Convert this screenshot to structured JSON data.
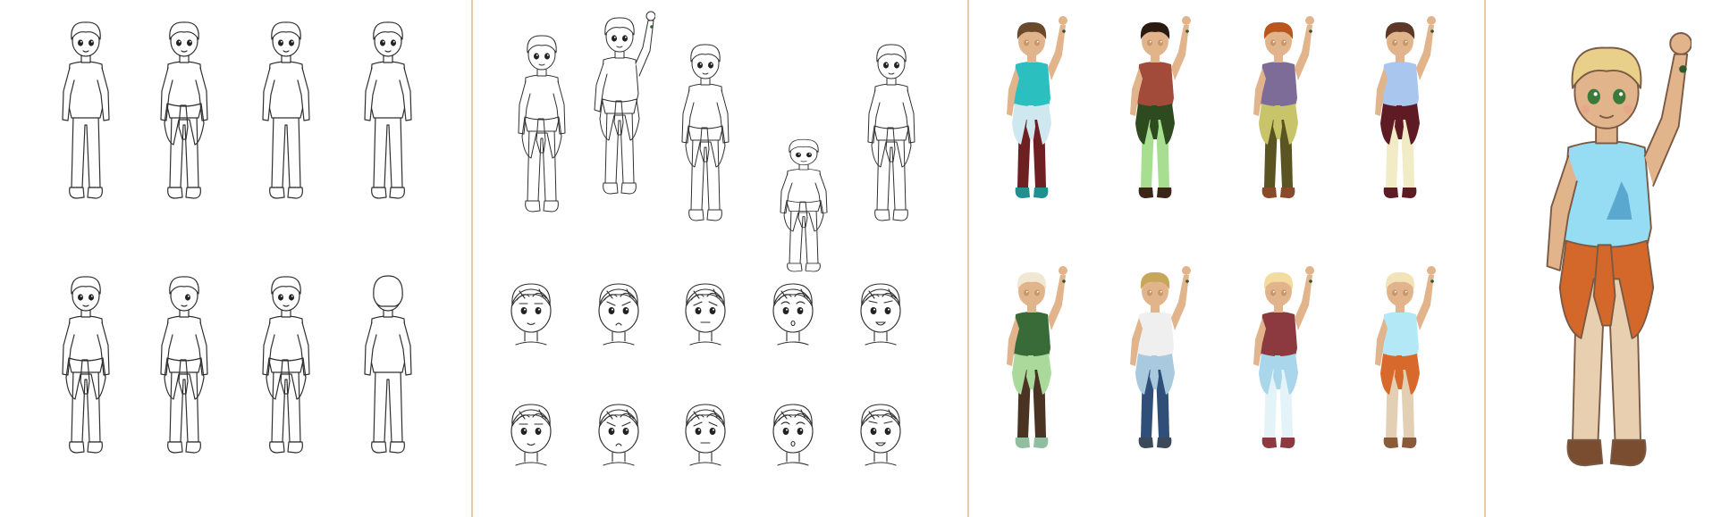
{
  "colors": {
    "background": "#ffffff",
    "divider": "#e8c9a8",
    "pencil": "#2f2f2f",
    "skin": "#e2b48c",
    "skin_shade": "#c9976c"
  },
  "panels": [
    {
      "id": "lineart-turnaround",
      "rows": 2,
      "cols": 4
    },
    {
      "id": "pose-and-expression-sketches",
      "poses": 5,
      "expression_rows": 2,
      "expression_cols": 5
    },
    {
      "id": "color-variations",
      "rows": 2,
      "cols": 4
    },
    {
      "id": "final-render",
      "rows": 1,
      "cols": 1
    }
  ],
  "color_variants": [
    {
      "hair": "#6b4a2b",
      "shirt": "#2bbfbf",
      "pants": "#6e1f22",
      "tie": "#cfe7ee",
      "shoes": "#1f8f8f"
    },
    {
      "hair": "#2b1a12",
      "shirt": "#a24b3a",
      "pants": "#a7de8f",
      "tie": "#2e4a1f",
      "shoes": "#3b2418"
    },
    {
      "hair": "#b8561e",
      "shirt": "#7d6b98",
      "pants": "#5a5422",
      "tie": "#c8c46a",
      "shoes": "#8a4a2a"
    },
    {
      "hair": "#5e3826",
      "shirt": "#a9c6ee",
      "pants": "#f1ecc5",
      "tie": "#5e1b23",
      "shoes": "#5e1b23"
    },
    {
      "hair": "#f1e7d2",
      "shirt": "#386b38",
      "pants": "#4a3322",
      "tie": "#a9d99b",
      "shoes": "#8fbfa0"
    },
    {
      "hair": "#c9a75a",
      "shirt": "#efefef",
      "pants": "#2f4f78",
      "tie": "#a9c9df",
      "shoes": "#3a4a5a"
    },
    {
      "hair": "#f2dca0",
      "shirt": "#8c3a3f",
      "pants": "#e3f3f8",
      "tie": "#a9d6ea",
      "shoes": "#8c3a3f"
    },
    {
      "hair": "#f3e3b8",
      "shirt": "#b3e9f7",
      "pants": "#e3cfb3",
      "tie": "#d8692c",
      "shoes": "#8a5a3a"
    }
  ],
  "final_render": {
    "hair": "#e8cf8a",
    "shirt": "#96dcf2",
    "pants": "#e8cfb0",
    "tie": "#d4682a",
    "shoes": "#7a4c30",
    "eyes": "#3a7a3a",
    "shirt_print_icon": "howling-wolf-icon"
  }
}
